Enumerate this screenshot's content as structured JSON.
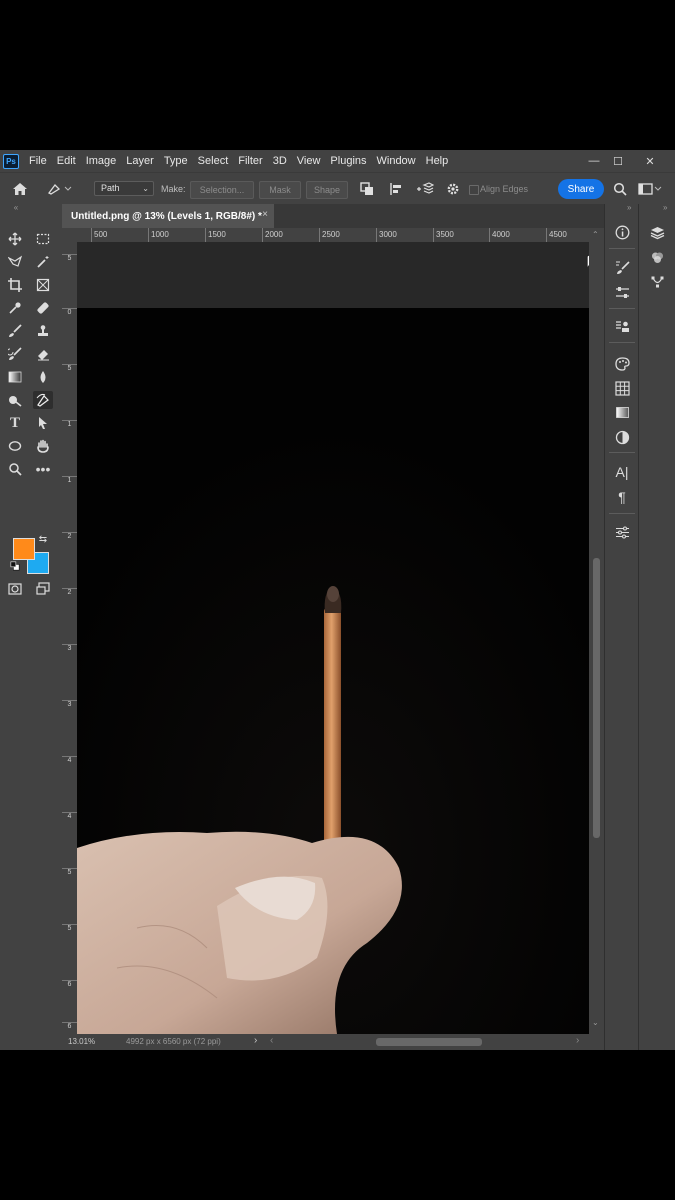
{
  "menu": {
    "app_badge": "Ps",
    "items": [
      "File",
      "Edit",
      "Image",
      "Layer",
      "Type",
      "Select",
      "Filter",
      "3D",
      "View",
      "Plugins",
      "Window",
      "Help"
    ]
  },
  "window_controls": {
    "minimize": "—",
    "maximize": "☐",
    "close": "✕"
  },
  "options_bar": {
    "path_mode": "Path",
    "make_label": "Make:",
    "selection_button": "Selection...",
    "mask_button": "Mask",
    "shape_button": "Shape",
    "align_edges_label": "Align Edges",
    "share_button": "Share"
  },
  "document_tab": {
    "title": "Untitled.png @ 13% (Levels 1, RGB/8#) *",
    "close": "×"
  },
  "ruler": {
    "top_labels": [
      "500",
      "1000",
      "1500",
      "2000",
      "2500",
      "3000",
      "3500",
      "4000",
      "4500"
    ],
    "left_labels": [
      "5",
      "0",
      "5",
      "1",
      "1",
      "2",
      "2",
      "3",
      "3",
      "4",
      "4",
      "5",
      "5",
      "6",
      "6"
    ]
  },
  "status_bar": {
    "zoom": "13.01%",
    "doc_info": "4992 px x 6560 px (72 ppi)",
    "arrow": "›"
  },
  "colors": {
    "foreground": "#ff8a1a",
    "background": "#1eaaf1",
    "accent": "#1473e6"
  },
  "icons": {
    "tools": [
      "move",
      "marquee",
      "lasso",
      "magic-wand",
      "crop",
      "frame",
      "eyedropper",
      "healing",
      "brush",
      "stamp",
      "history-brush",
      "eraser",
      "gradient",
      "blur",
      "dodge",
      "pen",
      "type",
      "path-select",
      "ellipse",
      "hand",
      "zoom",
      "more"
    ],
    "panels": [
      "info",
      "brush",
      "adjust",
      "layer-comps",
      "color",
      "swatches",
      "gradients",
      "patterns",
      "character",
      "paragraph",
      "properties",
      "layers",
      "channels",
      "paths"
    ]
  }
}
